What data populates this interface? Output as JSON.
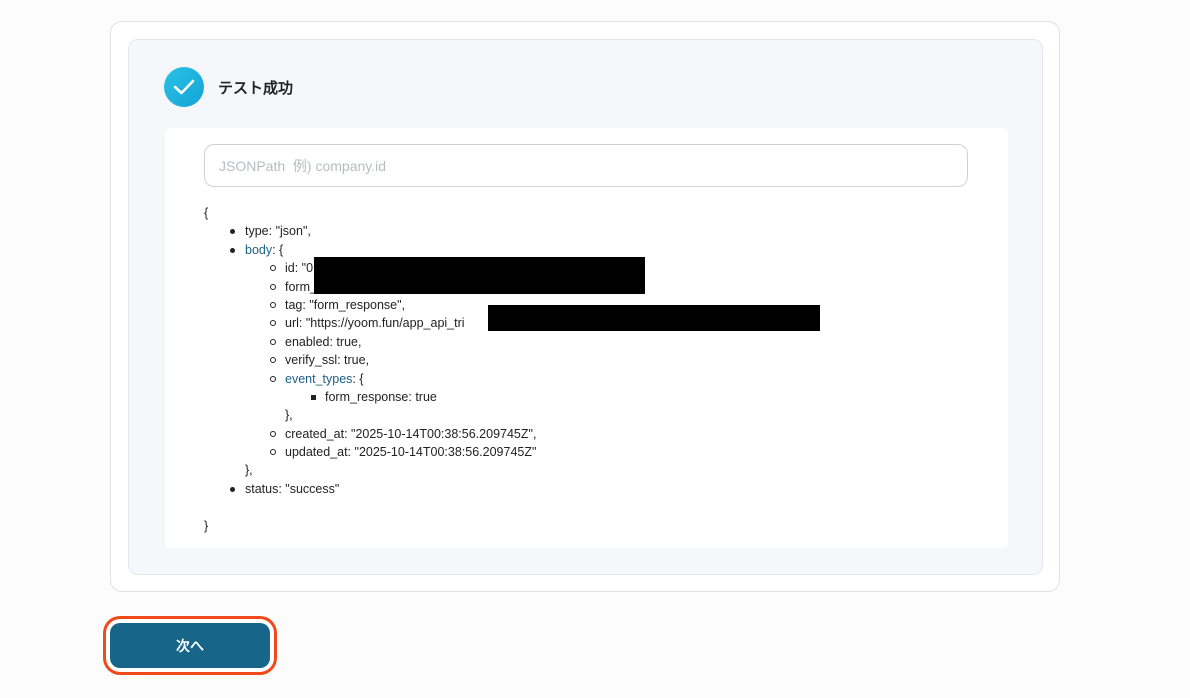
{
  "result": {
    "status_label": "テスト成功"
  },
  "search": {
    "placeholder": "JSONPath  例) company.id",
    "value": ""
  },
  "json_view": {
    "open_brace": "{",
    "close_brace": "}",
    "lines": {
      "type": "type: \"json\",",
      "body_key": "body",
      "body_open": ": {",
      "id": "id: \"0",
      "form": "form_",
      "tag": "tag: \"form_response\",",
      "url": "url: \"https://yoom.fun/app_api_tri",
      "enabled": "enabled: true,",
      "verify_ssl": "verify_ssl: true,",
      "event_types_key": "event_types",
      "event_types_open": ": {",
      "form_response": "form_response: true",
      "event_types_close": "},",
      "created_at": "created_at: \"2025-10-14T00:38:56.209745Z\",",
      "updated_at": "updated_at: \"2025-10-14T00:38:56.209745Z\"",
      "body_close": "},",
      "status": "status: \"success\""
    }
  },
  "footer": {
    "next_label": "次へ"
  }
}
